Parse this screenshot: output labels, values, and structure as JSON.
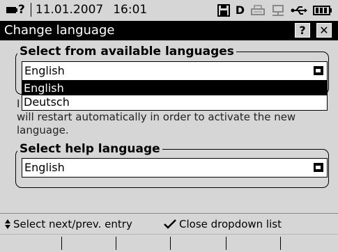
{
  "statusbar": {
    "device_label": "?",
    "date": "11.01.2007",
    "time": "16:01",
    "drive_letter": "D"
  },
  "titlebar": {
    "title": "Change language",
    "help_label": "?",
    "close_label": "✕"
  },
  "available": {
    "legend": "Select from available languages",
    "value": "English",
    "options": [
      "English",
      "Deutsch"
    ],
    "selected_index": 0
  },
  "info": {
    "text_prefix": "I",
    "text": "will restart automatically in order to activate the new language."
  },
  "help": {
    "legend": "Select help language",
    "value": "English"
  },
  "hints": {
    "nav": "Select next/prev. entry",
    "close": "Close dropdown list"
  }
}
